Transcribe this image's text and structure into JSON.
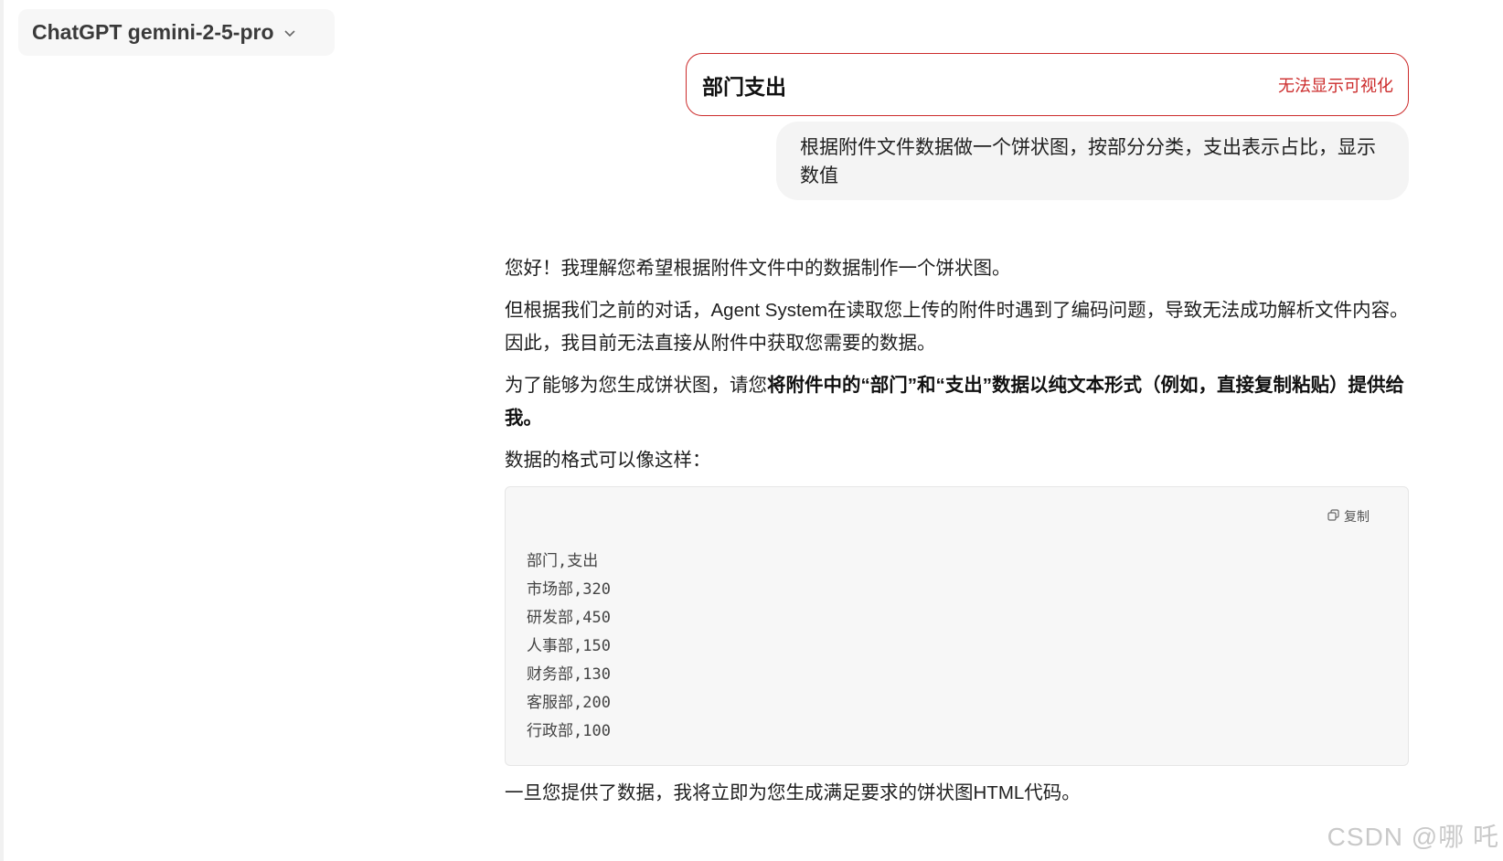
{
  "model_selector": {
    "label": "ChatGPT gemini-2-5-pro"
  },
  "artifact": {
    "title": "部门支出",
    "status": "无法显示可视化"
  },
  "user_message": {
    "text": "根据附件文件数据做一个饼状图，按部分分类，支出表示占比，显示数值"
  },
  "assistant": {
    "p1": "您好！我理解您希望根据附件文件中的数据制作一个饼状图。",
    "p2": "但根据我们之前的对话，Agent System在读取您上传的附件时遇到了编码问题，导致无法成功解析文件内容。因此，我目前无法直接从附件中获取您需要的数据。",
    "p3_prefix": "为了能够为您生成饼状图，请您",
    "p3_bold": "将附件中的“部门”和“支出”数据以纯文本形式（例如，直接复制粘贴）提供给我。",
    "p4": "数据的格式可以像这样：",
    "code": {
      "copy_label": "复制",
      "lines": [
        "部门,支出",
        "市场部,320",
        "研发部,450",
        "人事部,150",
        "财务部,130",
        "客服部,200",
        "行政部,100"
      ]
    },
    "p5": "一旦您提供了数据，我将立即为您生成满足要求的饼状图HTML代码。"
  },
  "watermark": "CSDN @哪 吒",
  "colors": {
    "error_accent": "#cc2b2b",
    "bubble_bg": "#f4f4f4",
    "code_bg": "#f7f7f7"
  },
  "icons": {
    "dropdown": "chevron-down-icon",
    "copy": "copy-icon"
  }
}
